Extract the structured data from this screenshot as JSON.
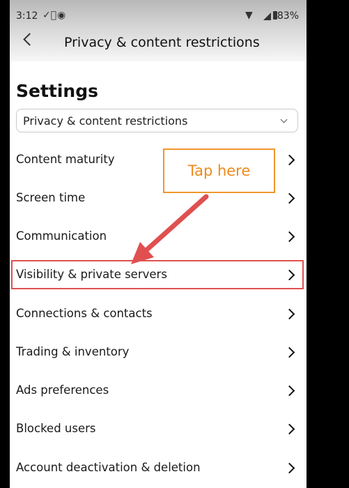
{
  "status_bar": {
    "time": "3:12",
    "battery": "83%",
    "icons": [
      "check-circle-icon",
      "target-icon",
      "wifi-icon",
      "signal-icon",
      "battery-icon"
    ]
  },
  "header": {
    "title": "Privacy & content restrictions"
  },
  "page": {
    "title": "Settings",
    "dropdown_value": "Privacy & content restrictions"
  },
  "menu_items": [
    {
      "label": "Content maturity"
    },
    {
      "label": "Screen time"
    },
    {
      "label": "Communication"
    },
    {
      "label": "Visibility & private servers"
    },
    {
      "label": "Connections & contacts"
    },
    {
      "label": "Trading & inventory"
    },
    {
      "label": "Ads preferences"
    },
    {
      "label": "Blocked users"
    },
    {
      "label": "Account deactivation & deletion"
    }
  ],
  "annotation": {
    "callout_text": "Tap here",
    "callout_color": "#f0962a",
    "arrow_color": "#e05050",
    "highlight_color": "#e05050"
  }
}
